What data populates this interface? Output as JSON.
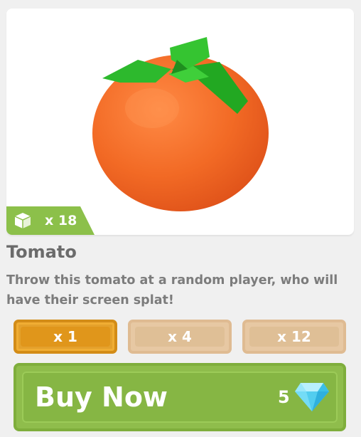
{
  "item": {
    "name": "Tomato",
    "description": "Throw this tomato at a random player, who will have their screen splat!",
    "owned_count": "x 18",
    "image_icon": "tomato-icon",
    "badge_icon": "box-icon"
  },
  "quantity_options": [
    {
      "label": "x 1",
      "selected": true
    },
    {
      "label": "x 4",
      "selected": false
    },
    {
      "label": "x 12",
      "selected": false
    }
  ],
  "purchase": {
    "button_label": "Buy Now",
    "price": "5",
    "currency_icon": "diamond-gem-icon"
  },
  "colors": {
    "accent_green": "#8cc04a",
    "selected_orange": "#e4a12c",
    "unselected_tan": "#e7c8a3",
    "text_gray": "#6b6b6b"
  }
}
